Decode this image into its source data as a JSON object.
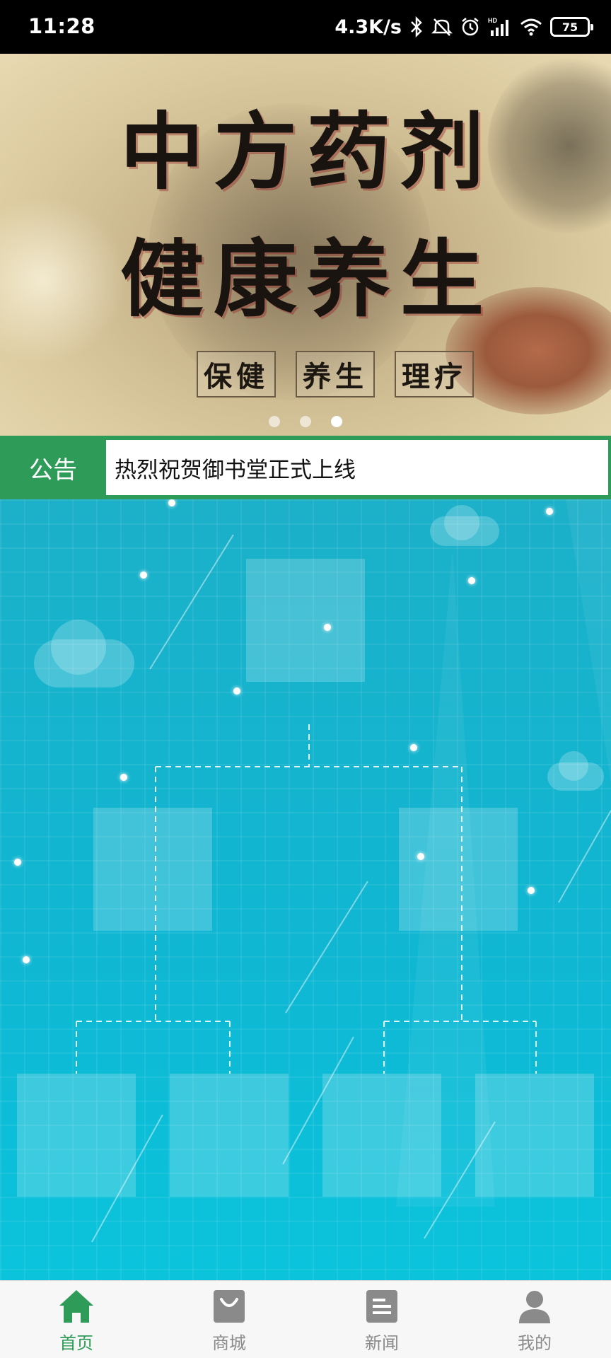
{
  "status_bar": {
    "time": "11:28",
    "net_speed": "4.3K/s",
    "network_type": "HD",
    "battery": "75",
    "icons": [
      "bluetooth-icon",
      "mute-icon",
      "alarm-icon",
      "signal-icon",
      "wifi-icon",
      "battery-icon"
    ]
  },
  "banner": {
    "line1": "中方药剂",
    "line2": "健康养生",
    "tags": [
      "保健",
      "养生",
      "理疗"
    ],
    "page_count": 3,
    "active_page": 3
  },
  "notice": {
    "label": "公告",
    "text": "热烈祝贺御书堂正式上线"
  },
  "tabbar": {
    "items": [
      {
        "label": "首页",
        "icon": "home-icon",
        "active": true
      },
      {
        "label": "商城",
        "icon": "shopping-bag-icon",
        "active": false
      },
      {
        "label": "新闻",
        "icon": "news-icon",
        "active": false
      },
      {
        "label": "我的",
        "icon": "user-icon",
        "active": false
      }
    ]
  },
  "colors": {
    "accent": "#2f9b58",
    "chart_background": "#13b5cf",
    "tab_inactive": "#8a8a8a"
  }
}
